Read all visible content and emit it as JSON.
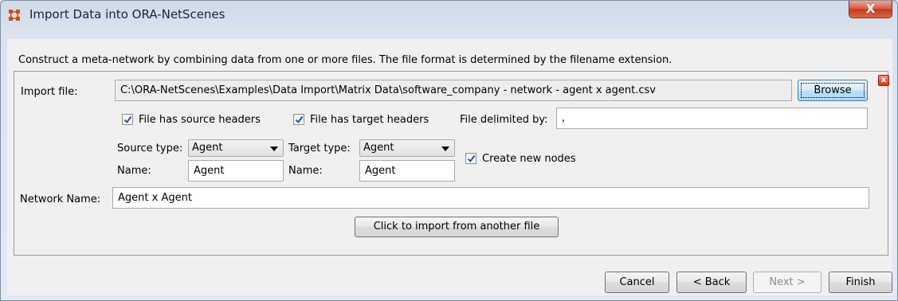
{
  "window": {
    "title": "Import Data into ORA-NetScenes",
    "close_glyph": "X"
  },
  "description": "Construct a meta-network by combining data from one or more files. The file format is determined by the filename extension.",
  "import": {
    "file_label": "Import file:",
    "file_path": "C:\\ORA-NetScenes\\Examples\\Data Import\\Matrix Data\\software_company - network - agent x agent.csv",
    "browse_label": "Browse",
    "source_headers_label": "File has source headers",
    "source_headers_checked": true,
    "target_headers_label": "File has target headers",
    "target_headers_checked": true,
    "delimited_label": "File delimited by:",
    "delimiter_value": ",",
    "source_type_label": "Source type:",
    "source_type_value": "Agent",
    "target_type_label": "Target type:",
    "target_type_value": "Agent",
    "source_name_label": "Name:",
    "source_name_value": "Agent",
    "target_name_label": "Name:",
    "target_name_value": "Agent",
    "create_nodes_label": "Create new nodes",
    "create_nodes_checked": true,
    "network_name_label": "Network Name:",
    "network_name_value": "Agent x Agent",
    "another_file_label": "Click to import from another file"
  },
  "footer": {
    "cancel_label": "Cancel",
    "back_label": "< Back",
    "next_label": "Next >",
    "finish_label": "Finish"
  },
  "icons": {
    "app": "network-app-icon",
    "remove": "remove-icon",
    "close": "close-icon"
  },
  "colors": {
    "remove_red": "#d23a22",
    "close_red": "#c3381f",
    "focus_blue": "#3c7fb1"
  }
}
